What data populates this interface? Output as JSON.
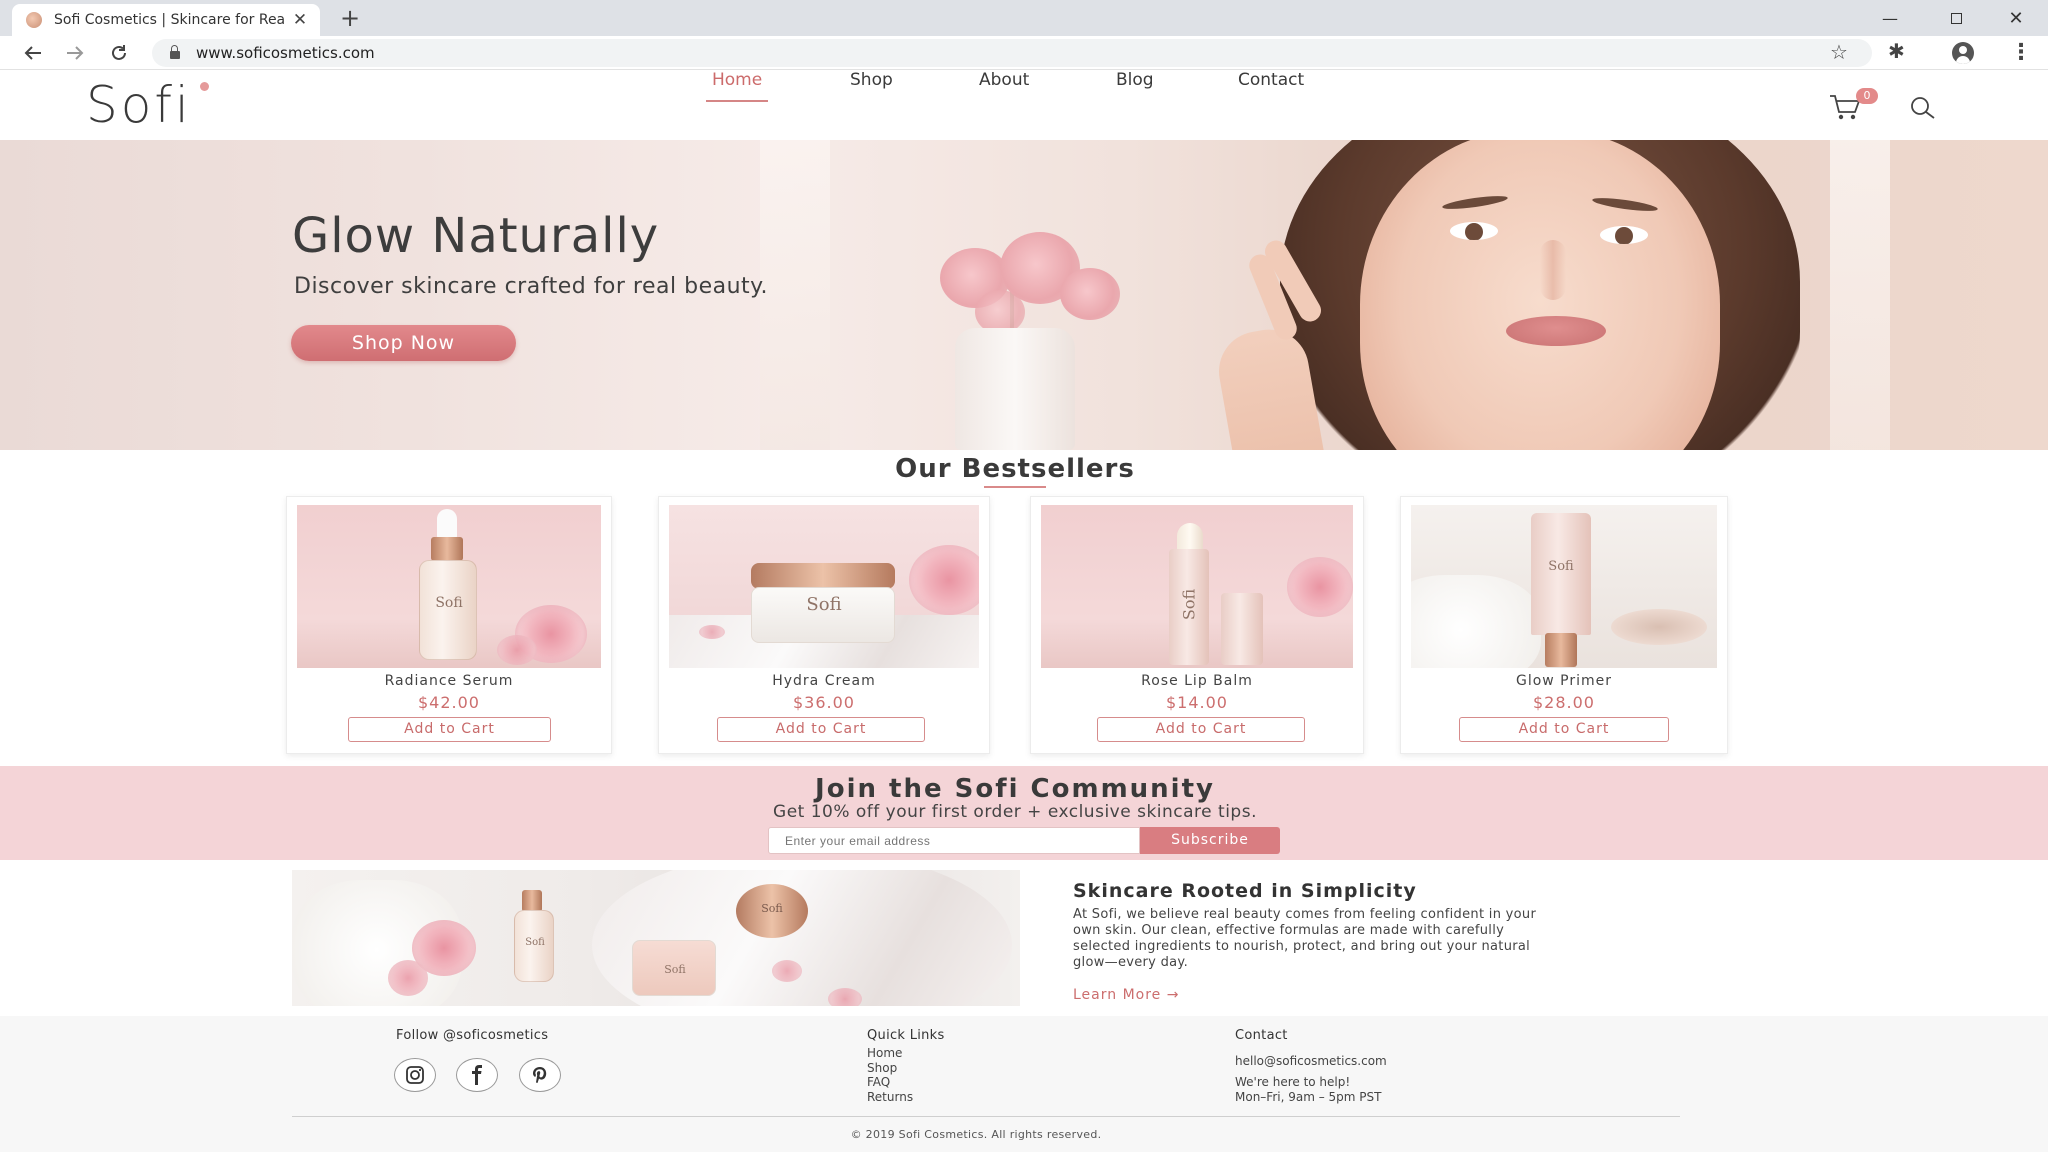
{
  "browser": {
    "tab_title": "Sofi Cosmetics | Skincare for Real Beauty",
    "url": "www.soficosmetics.com",
    "icons": [
      "back-arrow-icon",
      "forward-arrow-icon",
      "reload-icon",
      "lock-icon",
      "star-icon",
      "extension-icon",
      "profile-icon",
      "menu-icon"
    ]
  },
  "header": {
    "logo": "Sofi",
    "nav": [
      "Home",
      "Shop",
      "About",
      "Blog",
      "Contact"
    ],
    "active_nav": "Home",
    "cart_count": "0"
  },
  "hero": {
    "title": "Glow Naturally",
    "subtitle": "Discover skincare crafted for real beauty.",
    "cta": "Shop Now"
  },
  "bestsellers": {
    "title": "Our Bestsellers",
    "products": [
      {
        "name": "Radiance Serum",
        "price": "$42.00",
        "button": "Add to Cart",
        "label": "Sofi"
      },
      {
        "name": "Hydra Cream",
        "price": "$36.00",
        "button": "Add to Cart",
        "label": "Sofi"
      },
      {
        "name": "Rose Lip Balm",
        "price": "$14.00",
        "button": "Add to Cart",
        "label": "Sofi"
      },
      {
        "name": "Glow Primer",
        "price": "$28.00",
        "button": "Add to Cart",
        "label": "Sofi"
      }
    ]
  },
  "community": {
    "title": "Join the Sofi Community",
    "subtitle": "Get 10% off your first order + exclusive skincare tips.",
    "email_placeholder": "Enter your email address",
    "button": "Subscribe"
  },
  "story": {
    "title": "Skincare Rooted in Simplicity",
    "body": "At Sofi, we believe real beauty comes from feeling confident in your own skin. Our clean, effective formulas are made with carefully selected ingredients to nourish, protect, and bring out your natural glow—every day.",
    "link": "Learn More"
  },
  "footer": {
    "follow": "Follow @soficosmetics",
    "quick_links_title": "Quick Links",
    "quick_links": [
      "Home",
      "Shop",
      "FAQ",
      "Returns"
    ],
    "contact_title": "Contact",
    "email": "hello@soficosmetics.com",
    "help": "We're here to help!",
    "hours": "Mon–Fri, 9am – 5pm PST",
    "copyright": "© 2019 Sofi Cosmetics. All rights reserved."
  },
  "colors": {
    "accent": "#d97d81",
    "accent_text": "#cc6e6e",
    "band": "#f4d4d7"
  }
}
